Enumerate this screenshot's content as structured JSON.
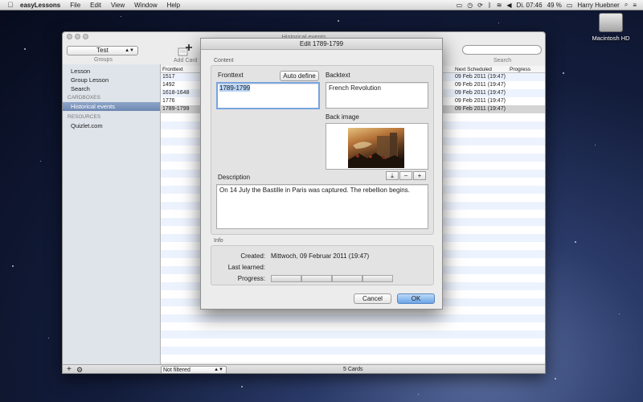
{
  "menubar": {
    "app_name": "easyLessons",
    "items": [
      "File",
      "Edit",
      "View",
      "Window",
      "Help"
    ],
    "clock": "Di. 07:46",
    "battery": "49 %",
    "user": "Harry Huebner"
  },
  "desktop": {
    "drive_label": "Macintosh HD"
  },
  "window": {
    "title": "Historical events",
    "group_selected": "Test",
    "groups_label": "Groups",
    "add_card_label": "Add Card",
    "search_label": "Search",
    "sidebar": {
      "items_top": [
        "Lesson",
        "Group Lesson",
        "Search"
      ],
      "cardboxes_header": "Cardboxes",
      "cardboxes": [
        "Historical events"
      ],
      "resources_header": "Resources",
      "resources": [
        "Quizlet.com"
      ]
    },
    "table": {
      "col_front": "Fronttext",
      "col_next": "Next Scheduled",
      "col_progress": "Progress",
      "rows": [
        {
          "front": "1517",
          "next": "09 Feb 2011 (19:47)"
        },
        {
          "front": "1492",
          "next": "09 Feb 2011 (19:47)"
        },
        {
          "front": "1618-1648",
          "next": "09 Feb 2011 (19:47)"
        },
        {
          "front": "1776",
          "next": "09 Feb 2011 (19:47)"
        },
        {
          "front": "1789-1799",
          "next": "09 Feb 2011 (19:47)"
        }
      ]
    },
    "bottom": {
      "filter": "Not filtered",
      "count": "5 Cards"
    }
  },
  "dialog": {
    "title": "Edit 1789-1799",
    "content_label": "Content",
    "fronttext_label": "Fronttext",
    "fronttext_value": "1789-1799",
    "auto_define_label": "Auto define",
    "backtext_label": "Backtext",
    "backtext_value": "French Revolution",
    "back_image_label": "Back image",
    "description_label": "Description",
    "description_value": "On 14 July the Bastille in Paris was captured. The rebellion begins.",
    "info_label": "Info",
    "created_label": "Created:",
    "created_value": "Mittwoch, 09 Februar 2011 (19:47)",
    "last_learned_label": "Last learned:",
    "last_learned_value": "",
    "progress_label": "Progress:",
    "cancel_label": "Cancel",
    "ok_label": "OK",
    "image_btn_minus": "−",
    "image_btn_plus": "+"
  }
}
